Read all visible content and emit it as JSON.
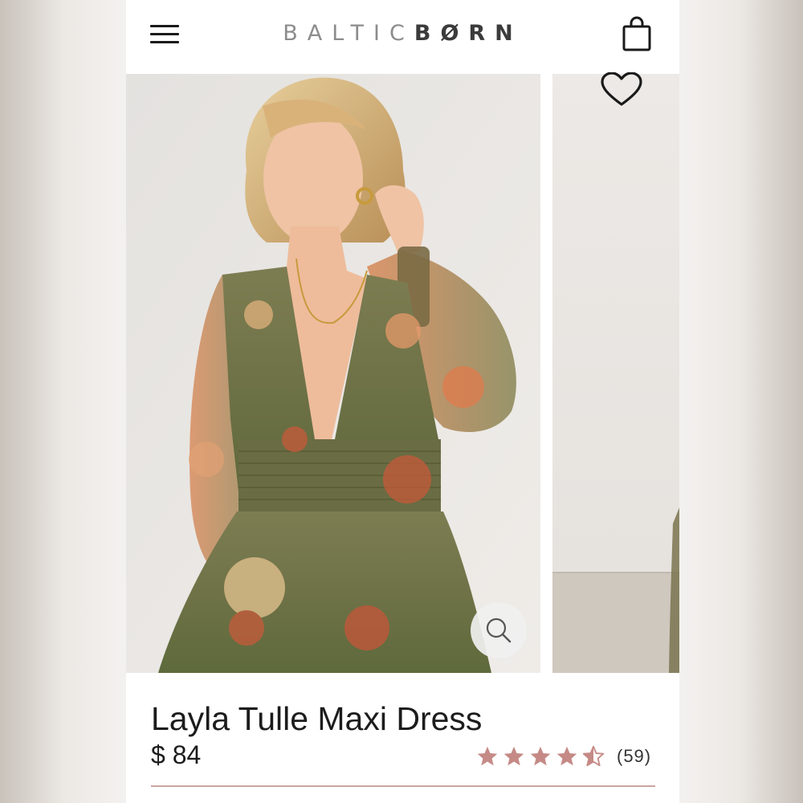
{
  "colors": {
    "accent_star": "#c58a86",
    "text": "#1c1c1c",
    "divider": "#c9a5a0"
  },
  "header": {
    "menu_icon": "hamburger-menu-icon",
    "logo_light": "BALTIC",
    "logo_dark": "BØRN",
    "cart_icon": "shopping-bag-icon"
  },
  "gallery": {
    "wishlist_icon": "heart-outline-icon",
    "zoom_icon": "magnifier-icon"
  },
  "product": {
    "name": "Layla Tulle Maxi Dress",
    "price": "$ 84",
    "rating": 4.5,
    "rating_max": 5,
    "review_count": "(59)"
  }
}
